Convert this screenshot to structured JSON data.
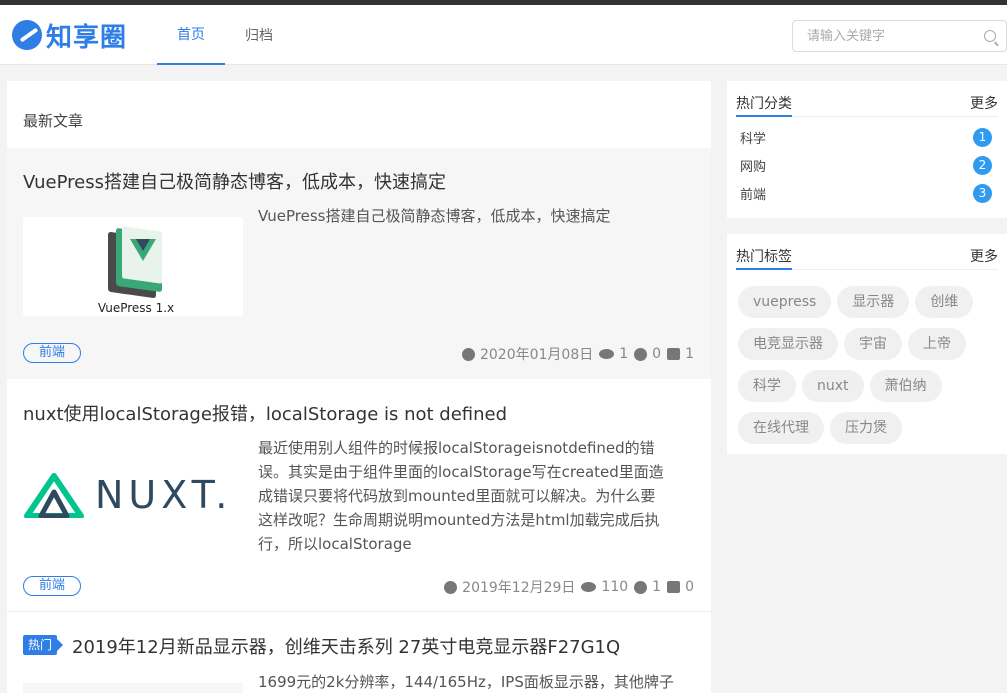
{
  "brand": {
    "name": "知享圈"
  },
  "nav": {
    "items": [
      {
        "label": "首页",
        "active": true
      },
      {
        "label": "归档",
        "active": false
      }
    ]
  },
  "search": {
    "placeholder": "请输入关键字"
  },
  "main": {
    "title": "最新文章",
    "articles": [
      {
        "title": "VuePress搭建自己极简静态博客，低成本，快速搞定",
        "thumb_caption": "VuePress 1.x",
        "description": "VuePress搭建自己极简静态博客，低成本，快速搞定",
        "category": "前端",
        "date": "2020年01月08日",
        "views": "1",
        "comments": "0",
        "likes": "1"
      },
      {
        "title": "nuxt使用localStorage报错，localStorage is not defined",
        "thumb_caption": "NUXT.",
        "description_lines": [
          "最近使用别人组件的时候报localStorageisnotdefined的错",
          "误。其实是由于组件里面的localStorage写在created里面造",
          "成错误只要将代码放到mounted里面就可以解决。为什么要",
          "这样改呢？生命周期说明mounted方法是html加载完成后执",
          "行，所以localStorage"
        ],
        "category": "前端",
        "date": "2019年12月29日",
        "views": "110",
        "comments": "1",
        "likes": "0"
      },
      {
        "badge": "热门",
        "title": "2019年12月新品显示器，创维天击系列 27英寸电竞显示器F27G1Q",
        "description": "1699元的2k分辨率，144/165Hz，IPS面板显示器，其他牌子"
      }
    ]
  },
  "sidebar": {
    "categories": {
      "title": "热门分类",
      "more": "更多",
      "items": [
        {
          "label": "科学",
          "count": "1"
        },
        {
          "label": "网购",
          "count": "2"
        },
        {
          "label": "前端",
          "count": "3"
        }
      ]
    },
    "tags": {
      "title": "热门标签",
      "more": "更多",
      "items": [
        "vuepress",
        "显示器",
        "创维",
        "电竞显示器",
        "宇宙",
        "上帝",
        "科学",
        "nuxt",
        "萧伯纳",
        "在线代理",
        "压力煲"
      ]
    }
  },
  "colors": {
    "accent": "#2f7ee6",
    "badge": "#2f9bf0",
    "nuxt_green": "#00c58e",
    "nuxt_dark": "#2f495e"
  }
}
